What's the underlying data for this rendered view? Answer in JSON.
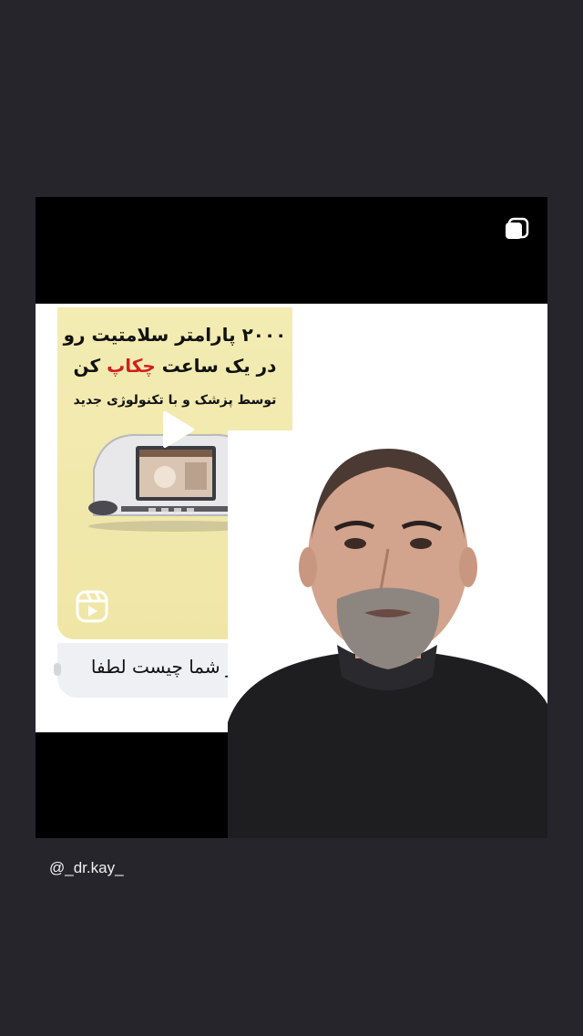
{
  "post": {
    "reel": {
      "line1": "۲۰۰۰ پارامتر سلامتیت رو",
      "line2_before": "در یک ساعت ",
      "line2_highlight": "چکاپ",
      "line2_after": " کن",
      "line3": "توسط پزشک و با تکنولوژی جدید"
    },
    "comment": "نظر شما چیست لطفا",
    "icons": {
      "share": "share-icon",
      "play": "play-icon",
      "reels": "reels-icon"
    }
  },
  "user": {
    "handle": "@_dr.kay_"
  },
  "colors": {
    "background": "#26252b",
    "reel_yellow": "#f3ecb3",
    "highlight_red": "#d11f1f",
    "bubble": "#eef0f4"
  }
}
